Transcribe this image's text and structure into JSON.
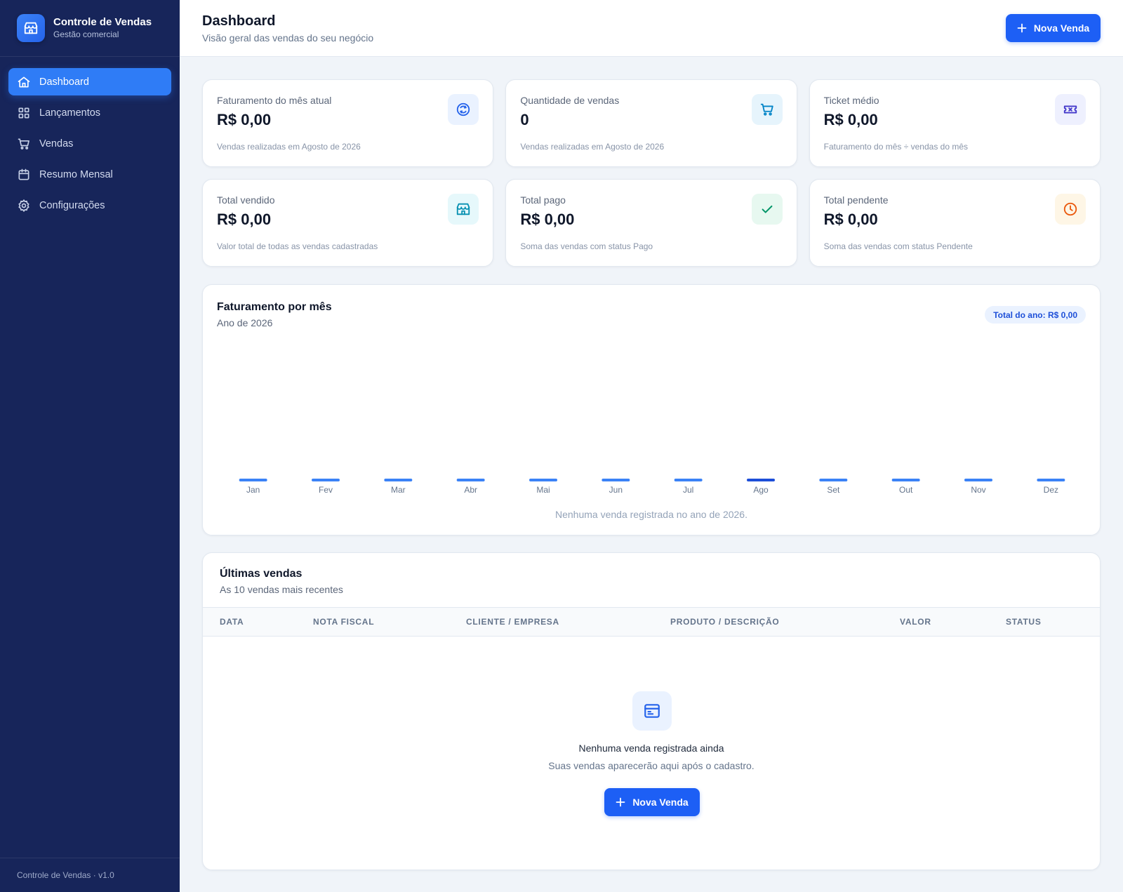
{
  "app": {
    "title": "Controle de Vendas",
    "subtitle": "Gestão comercial",
    "footer": "Controle de Vendas · v1.0"
  },
  "nav": {
    "items": [
      {
        "label": "Dashboard",
        "icon": "home-icon",
        "active": true
      },
      {
        "label": "Lançamentos",
        "icon": "grid-icon",
        "active": false
      },
      {
        "label": "Vendas",
        "icon": "cart-icon",
        "active": false
      },
      {
        "label": "Resumo Mensal",
        "icon": "calendar-icon",
        "active": false
      },
      {
        "label": "Configurações",
        "icon": "gear-icon",
        "active": false
      }
    ]
  },
  "header": {
    "title": "Dashboard",
    "subtitle": "Visão geral das vendas do seu negócio",
    "new_sale_label": "Nova Venda"
  },
  "stats": [
    {
      "label": "Faturamento do mês atual",
      "value": "R$ 0,00",
      "note": "Vendas realizadas em Agosto de 2026",
      "icon": "coin-icon",
      "color": "#2563eb",
      "bg": "#eaf2ff"
    },
    {
      "label": "Quantidade de vendas",
      "value": "0",
      "note": "Vendas realizadas em Agosto de 2026",
      "icon": "cart-icon",
      "color": "#0284c7",
      "bg": "#e6f4fc"
    },
    {
      "label": "Ticket médio",
      "value": "R$ 0,00",
      "note": "Faturamento do mês ÷ vendas do mês",
      "icon": "ticket-icon",
      "color": "#4338ca",
      "bg": "#eef0fe"
    },
    {
      "label": "Total vendido",
      "value": "R$ 0,00",
      "note": "Valor total de todas as vendas cadastradas",
      "icon": "store-icon",
      "color": "#0891b2",
      "bg": "#e6f8fb"
    },
    {
      "label": "Total pago",
      "value": "R$ 0,00",
      "note": "Soma das vendas com status Pago",
      "icon": "check-icon",
      "color": "#059669",
      "bg": "#e7f8f0"
    },
    {
      "label": "Total pendente",
      "value": "R$ 0,00",
      "note": "Soma das vendas com status Pendente",
      "icon": "clock-icon",
      "color": "#ea580c",
      "bg": "#fef6e6"
    }
  ],
  "chart": {
    "title": "Faturamento por mês",
    "subtitle": "Ano de 2026",
    "total_badge": "Total do ano: R$ 0,00",
    "empty_message": "Nenhuma venda registrada no ano de 2026.",
    "bar_color": "#3b82f6",
    "highlight_color": "#1d4ed8"
  },
  "chart_data": {
    "type": "bar",
    "categories": [
      "Jan",
      "Fev",
      "Mar",
      "Abr",
      "Mai",
      "Jun",
      "Jul",
      "Ago",
      "Set",
      "Out",
      "Nov",
      "Dez"
    ],
    "values": [
      0,
      0,
      0,
      0,
      0,
      0,
      0,
      0,
      0,
      0,
      0,
      0
    ],
    "highlighted_category": "Ago",
    "title": "Faturamento por mês",
    "subtitle": "Ano de 2026",
    "xlabel": "",
    "ylabel": "",
    "grid": false
  },
  "sales_table": {
    "title": "Últimas vendas",
    "subtitle": "As 10 vendas mais recentes",
    "columns": [
      "DATA",
      "NOTA FISCAL",
      "CLIENTE / EMPRESA",
      "PRODUTO / DESCRIÇÃO",
      "VALOR",
      "STATUS"
    ],
    "rows": [],
    "empty_title": "Nenhuma venda registrada ainda",
    "empty_subtitle": "Suas vendas aparecerão aqui após o cadastro.",
    "empty_button_label": "Nova Venda"
  },
  "colors": {
    "sidebar_bg": "#17255a",
    "accent": "#1d5ff5",
    "nav_active": "#2f7cf6",
    "page_bg": "#f0f4f9"
  }
}
